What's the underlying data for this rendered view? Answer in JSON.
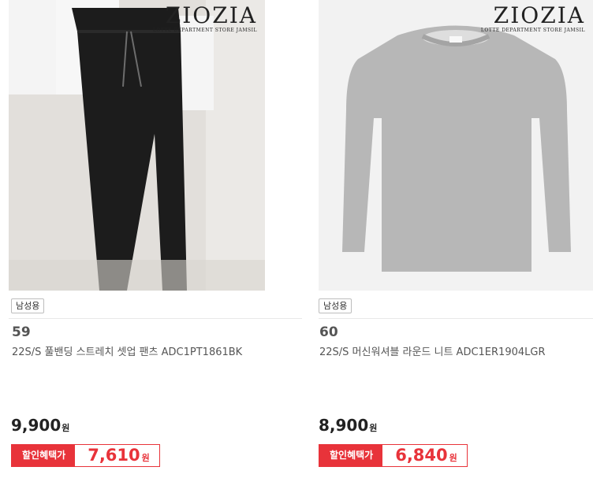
{
  "products": [
    {
      "brand": "ZIOZIA",
      "brand_sub": "LOTTE DEPARTMENT STORE JAMSIL",
      "badge": "남성용",
      "number": "59",
      "title": "22S/S 풀밴딩 스트레치 셋업 팬츠 ADC1PT1861BK",
      "price": "9,900",
      "currency": "원",
      "discount_label": "할인혜택가",
      "discount_price": "7,610",
      "discount_currency": "원",
      "image_icon": "black-pants-image"
    },
    {
      "brand": "ZIOZIA",
      "brand_sub": "LOTTE DEPARTMENT STORE JAMSIL",
      "badge": "남성용",
      "number": "60",
      "title": "22S/S 머신워셔블 라운드 니트 ADC1ER1904LGR",
      "price": "8,900",
      "currency": "원",
      "discount_label": "할인혜택가",
      "discount_price": "6,840",
      "discount_currency": "원",
      "image_icon": "grey-sweater-image"
    }
  ],
  "colors": {
    "accent": "#e8333a",
    "text": "#222222",
    "muted": "#555555"
  }
}
